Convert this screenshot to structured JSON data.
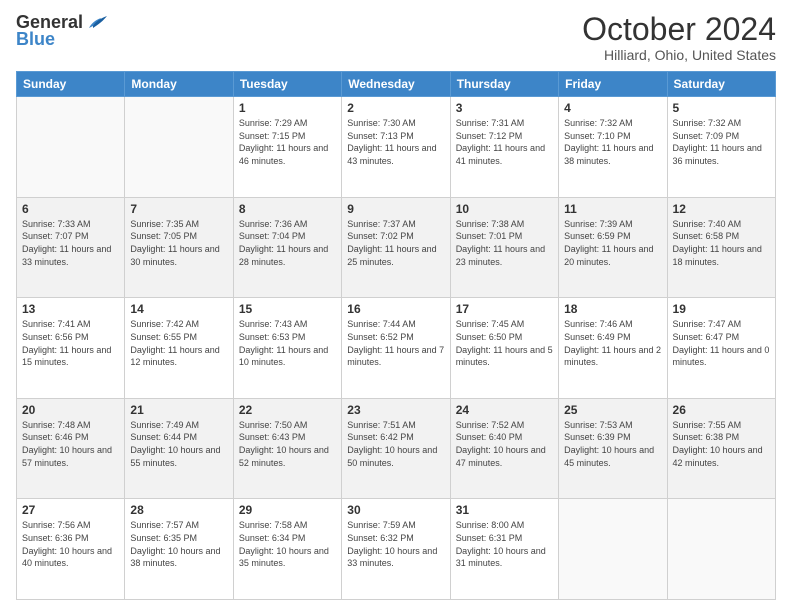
{
  "header": {
    "logo_general": "General",
    "logo_blue": "Blue",
    "month_title": "October 2024",
    "location": "Hilliard, Ohio, United States"
  },
  "days_of_week": [
    "Sunday",
    "Monday",
    "Tuesday",
    "Wednesday",
    "Thursday",
    "Friday",
    "Saturday"
  ],
  "weeks": [
    [
      {
        "day": "",
        "info": ""
      },
      {
        "day": "",
        "info": ""
      },
      {
        "day": "1",
        "info": "Sunrise: 7:29 AM\nSunset: 7:15 PM\nDaylight: 11 hours and 46 minutes."
      },
      {
        "day": "2",
        "info": "Sunrise: 7:30 AM\nSunset: 7:13 PM\nDaylight: 11 hours and 43 minutes."
      },
      {
        "day": "3",
        "info": "Sunrise: 7:31 AM\nSunset: 7:12 PM\nDaylight: 11 hours and 41 minutes."
      },
      {
        "day": "4",
        "info": "Sunrise: 7:32 AM\nSunset: 7:10 PM\nDaylight: 11 hours and 38 minutes."
      },
      {
        "day": "5",
        "info": "Sunrise: 7:32 AM\nSunset: 7:09 PM\nDaylight: 11 hours and 36 minutes."
      }
    ],
    [
      {
        "day": "6",
        "info": "Sunrise: 7:33 AM\nSunset: 7:07 PM\nDaylight: 11 hours and 33 minutes."
      },
      {
        "day": "7",
        "info": "Sunrise: 7:35 AM\nSunset: 7:05 PM\nDaylight: 11 hours and 30 minutes."
      },
      {
        "day": "8",
        "info": "Sunrise: 7:36 AM\nSunset: 7:04 PM\nDaylight: 11 hours and 28 minutes."
      },
      {
        "day": "9",
        "info": "Sunrise: 7:37 AM\nSunset: 7:02 PM\nDaylight: 11 hours and 25 minutes."
      },
      {
        "day": "10",
        "info": "Sunrise: 7:38 AM\nSunset: 7:01 PM\nDaylight: 11 hours and 23 minutes."
      },
      {
        "day": "11",
        "info": "Sunrise: 7:39 AM\nSunset: 6:59 PM\nDaylight: 11 hours and 20 minutes."
      },
      {
        "day": "12",
        "info": "Sunrise: 7:40 AM\nSunset: 6:58 PM\nDaylight: 11 hours and 18 minutes."
      }
    ],
    [
      {
        "day": "13",
        "info": "Sunrise: 7:41 AM\nSunset: 6:56 PM\nDaylight: 11 hours and 15 minutes."
      },
      {
        "day": "14",
        "info": "Sunrise: 7:42 AM\nSunset: 6:55 PM\nDaylight: 11 hours and 12 minutes."
      },
      {
        "day": "15",
        "info": "Sunrise: 7:43 AM\nSunset: 6:53 PM\nDaylight: 11 hours and 10 minutes."
      },
      {
        "day": "16",
        "info": "Sunrise: 7:44 AM\nSunset: 6:52 PM\nDaylight: 11 hours and 7 minutes."
      },
      {
        "day": "17",
        "info": "Sunrise: 7:45 AM\nSunset: 6:50 PM\nDaylight: 11 hours and 5 minutes."
      },
      {
        "day": "18",
        "info": "Sunrise: 7:46 AM\nSunset: 6:49 PM\nDaylight: 11 hours and 2 minutes."
      },
      {
        "day": "19",
        "info": "Sunrise: 7:47 AM\nSunset: 6:47 PM\nDaylight: 11 hours and 0 minutes."
      }
    ],
    [
      {
        "day": "20",
        "info": "Sunrise: 7:48 AM\nSunset: 6:46 PM\nDaylight: 10 hours and 57 minutes."
      },
      {
        "day": "21",
        "info": "Sunrise: 7:49 AM\nSunset: 6:44 PM\nDaylight: 10 hours and 55 minutes."
      },
      {
        "day": "22",
        "info": "Sunrise: 7:50 AM\nSunset: 6:43 PM\nDaylight: 10 hours and 52 minutes."
      },
      {
        "day": "23",
        "info": "Sunrise: 7:51 AM\nSunset: 6:42 PM\nDaylight: 10 hours and 50 minutes."
      },
      {
        "day": "24",
        "info": "Sunrise: 7:52 AM\nSunset: 6:40 PM\nDaylight: 10 hours and 47 minutes."
      },
      {
        "day": "25",
        "info": "Sunrise: 7:53 AM\nSunset: 6:39 PM\nDaylight: 10 hours and 45 minutes."
      },
      {
        "day": "26",
        "info": "Sunrise: 7:55 AM\nSunset: 6:38 PM\nDaylight: 10 hours and 42 minutes."
      }
    ],
    [
      {
        "day": "27",
        "info": "Sunrise: 7:56 AM\nSunset: 6:36 PM\nDaylight: 10 hours and 40 minutes."
      },
      {
        "day": "28",
        "info": "Sunrise: 7:57 AM\nSunset: 6:35 PM\nDaylight: 10 hours and 38 minutes."
      },
      {
        "day": "29",
        "info": "Sunrise: 7:58 AM\nSunset: 6:34 PM\nDaylight: 10 hours and 35 minutes."
      },
      {
        "day": "30",
        "info": "Sunrise: 7:59 AM\nSunset: 6:32 PM\nDaylight: 10 hours and 33 minutes."
      },
      {
        "day": "31",
        "info": "Sunrise: 8:00 AM\nSunset: 6:31 PM\nDaylight: 10 hours and 31 minutes."
      },
      {
        "day": "",
        "info": ""
      },
      {
        "day": "",
        "info": ""
      }
    ]
  ]
}
